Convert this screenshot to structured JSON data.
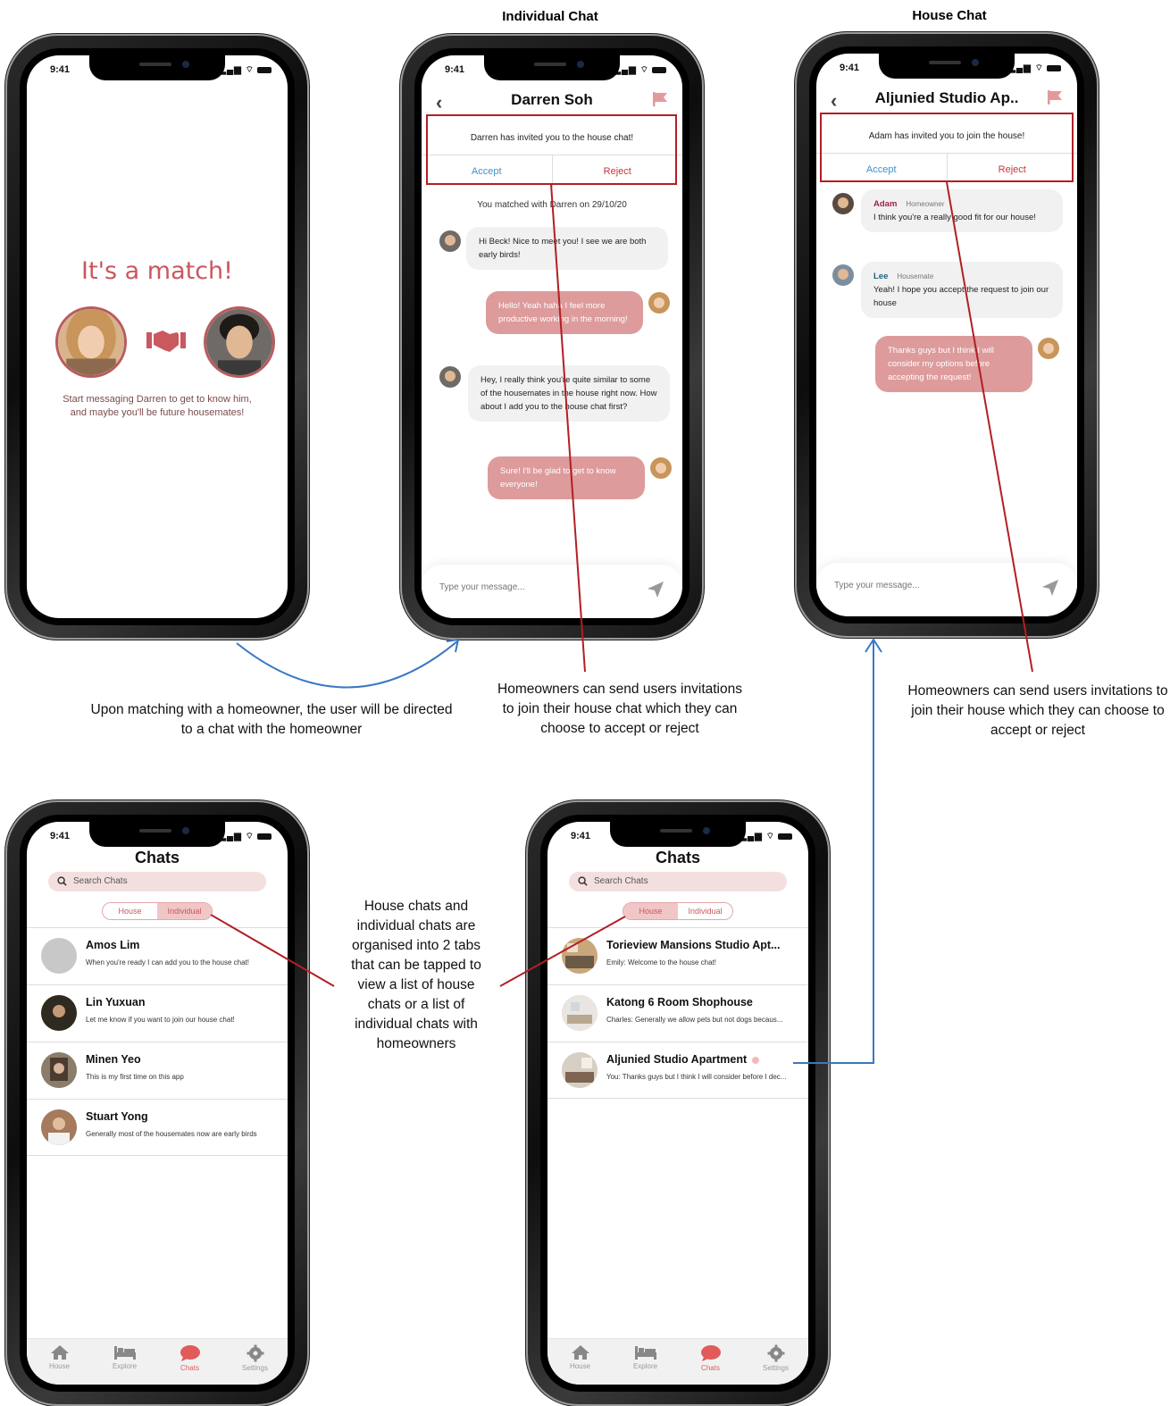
{
  "titles": {
    "individual_chat": "Individual Chat",
    "house_chat": "House Chat"
  },
  "status": {
    "time": "9:41"
  },
  "match": {
    "title": "It's a match!",
    "description": "Start messaging Darren to get to know him, and maybe you'll be future housemates!"
  },
  "individual": {
    "header": "Darren Soh",
    "invite_text": "Darren has invited you to the house chat!",
    "accept": "Accept",
    "reject": "Reject",
    "system": "You matched with Darren on 29/10/20",
    "messages": [
      {
        "text": "Hi Beck!  Nice to meet you! I see we are both early birds!"
      },
      {
        "text": "Hello! Yeah haha I feel more productive working in the morning!"
      },
      {
        "text": "Hey, I really think you're quite similar to some of the housemates in the house right now. How about I add you to the house chat first?"
      },
      {
        "text": "Sure! I'll be glad to get to know everyone!"
      }
    ],
    "placeholder": "Type your message..."
  },
  "house": {
    "header": "Aljunied Studio Ap..",
    "invite_text": "Adam has invited you to join the house!",
    "accept": "Accept",
    "reject": "Reject",
    "messages": [
      {
        "sender": "Adam",
        "role": "Homeowner",
        "text": "I think you're a really good fit for our house!"
      },
      {
        "sender": "Lee",
        "role": "Housemate",
        "text": "Yeah! I hope you accept the request to join our house"
      },
      {
        "text": "Thanks guys but I think I will consider my options before accepting the request!"
      }
    ],
    "placeholder": "Type your message..."
  },
  "chats_individual": {
    "title": "Chats",
    "search_placeholder": "Search Chats",
    "tabs": [
      "House",
      "Individual"
    ],
    "items": [
      {
        "name": "Amos Lim",
        "preview": "When you're ready I can add you to the house chat!"
      },
      {
        "name": "Lin Yuxuan",
        "preview": "Let me know if you want to join our house chat!"
      },
      {
        "name": "Minen Yeo",
        "preview": "This is my first time on this app"
      },
      {
        "name": "Stuart Yong",
        "preview": "Generally most of the housemates now are early birds"
      }
    ]
  },
  "chats_house": {
    "title": "Chats",
    "search_placeholder": "Search Chats",
    "tabs": [
      "House",
      "Individual"
    ],
    "items": [
      {
        "name": "Torieview Mansions Studio Apt...",
        "preview": "Emily:  Welcome to the house chat!"
      },
      {
        "name": "Katong 6 Room Shophouse",
        "preview": "Charles:  Generally we allow pets but not dogs becaus..."
      },
      {
        "name": "Aljunied Studio Apartment",
        "preview": "You: Thanks guys but I think I will consider before I dec..."
      }
    ]
  },
  "tabbar": [
    "House",
    "Explore",
    "Chats",
    "Settings"
  ],
  "captions": {
    "match_to_chat": "Upon matching with a homeowner, the user will be directed to a chat with the homeowner",
    "individual_invite": "Homeowners can send users invitations to join their house chat which they can choose to accept or reject",
    "house_invite": "Homeowners can send users invitations to join their house which they can choose to accept or reject",
    "tabs": "House chats and individual chats are organised into 2 tabs that can be tapped to view a list of house chats or a list of individual chats with homeowners"
  },
  "colors": {
    "accent": "#c9585f",
    "bubble_out": "#dd9b9c",
    "annotation_red": "#b21f24",
    "annotation_blue": "#3a78c2"
  }
}
